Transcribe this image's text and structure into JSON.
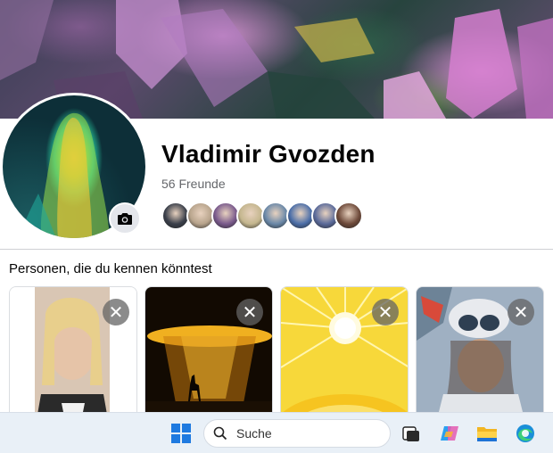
{
  "profile": {
    "name": "Vladimir Gvozden",
    "friends_count": "56 Freunde"
  },
  "friend_avatars": [
    {
      "color": "#3a3f4a"
    },
    {
      "color": "#b8a48c"
    },
    {
      "color": "#7a5a8c"
    },
    {
      "color": "#c4b68e"
    },
    {
      "color": "#6a88a8"
    },
    {
      "color": "#4b6ea8"
    },
    {
      "color": "#5a6a9a"
    },
    {
      "color": "#6e4a3a"
    }
  ],
  "pymk": {
    "title": "Personen, die du kennen könntest"
  },
  "taskbar": {
    "search_label": "Suche"
  },
  "colors": {
    "accent": "#0866ff",
    "text": "#050505",
    "muted": "#65676b"
  }
}
